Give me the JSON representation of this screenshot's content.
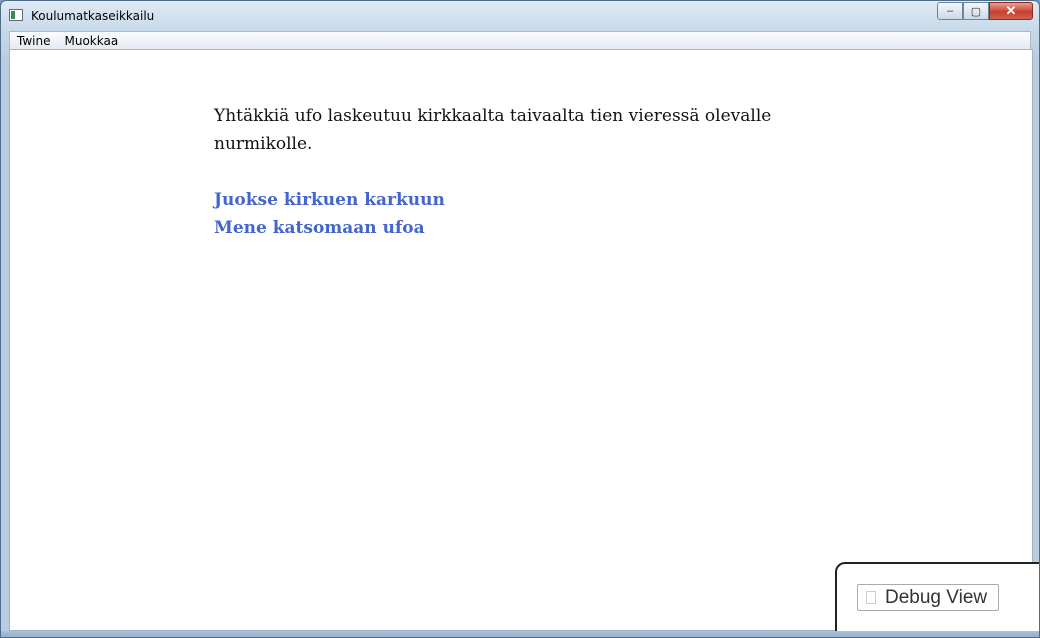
{
  "window": {
    "title": "Koulumatkaseikkailu",
    "icon": "app-window-icon",
    "controls": {
      "minimize": "–",
      "maximize": "▢",
      "close": "✕"
    }
  },
  "menubar": {
    "items": [
      {
        "label": "Twine"
      },
      {
        "label": "Muokkaa"
      }
    ]
  },
  "story": {
    "passage_text": "Yhtäkkiä ufo laskeutuu kirkkaalta taivaalta tien vieressä olevalle nurmikolle.",
    "links": [
      {
        "label": "Juokse kirkuen karkuun"
      },
      {
        "label": "Mene katsomaan ufoa"
      }
    ],
    "link_color": "#4466cc"
  },
  "debug": {
    "button_label": "Debug View",
    "icon": "debug-icon"
  }
}
